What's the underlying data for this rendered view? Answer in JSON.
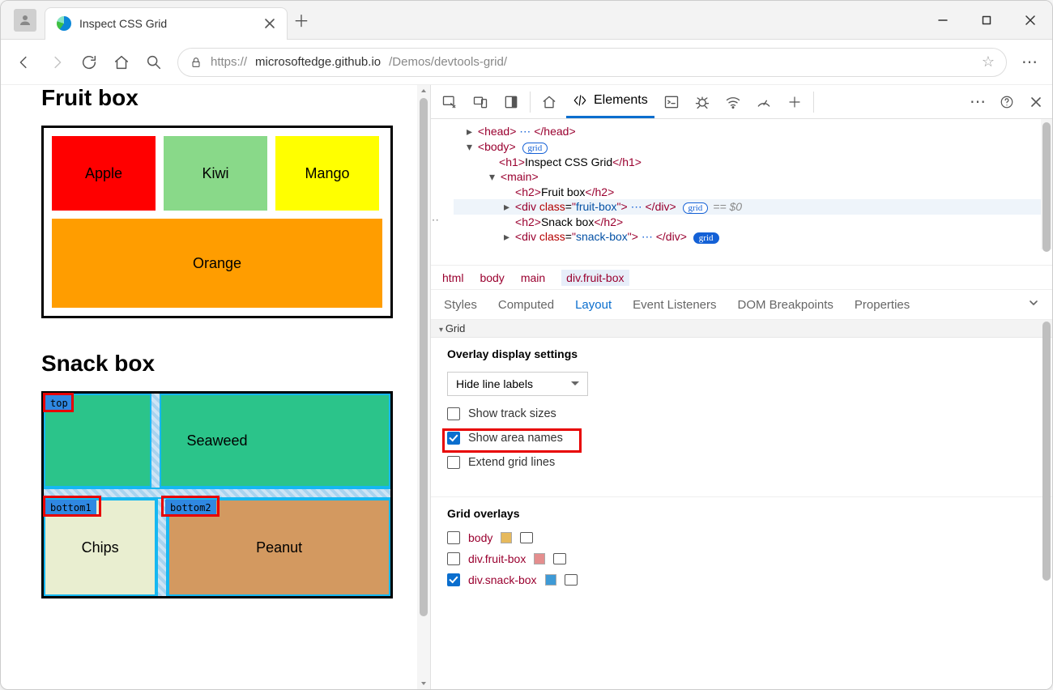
{
  "browser": {
    "tab_title": "Inspect CSS Grid",
    "url_prefix": "https://",
    "url_mid": "microsoftedge.github.io",
    "url_rest": "/Demos/devtools-grid/"
  },
  "page": {
    "h2_fruit": "Fruit box",
    "h2_snack": "Snack box",
    "fruits": {
      "apple": "Apple",
      "kiwi": "Kiwi",
      "mango": "Mango",
      "orange": "Orange"
    },
    "snacks": {
      "seaweed": "Seaweed",
      "chips": "Chips",
      "peanut": "Peanut"
    },
    "area_labels": {
      "top": "top",
      "bottom1": "bottom1",
      "bottom2": "bottom2"
    }
  },
  "dom": {
    "head": "head",
    "body": "body",
    "grid_badge": "grid",
    "h1_text": "Inspect CSS Grid",
    "main": "main",
    "h2_fruit": "Fruit box",
    "h2_snack": "Snack box",
    "div": "div",
    "class_attr": "class",
    "fruit_val": "fruit-box",
    "snack_val": "snack-box",
    "sel_extra": "== $0"
  },
  "breadcrumbs": {
    "html": "html",
    "body": "body",
    "main": "main",
    "sel": "div.fruit-box"
  },
  "styles_tabs": {
    "styles": "Styles",
    "computed": "Computed",
    "layout": "Layout",
    "listeners": "Event Listeners",
    "dombp": "DOM Breakpoints",
    "props": "Properties"
  },
  "layout": {
    "grid_section": "Grid",
    "overlay_h": "Overlay display settings",
    "dropdown": "Hide line labels",
    "opt_tracks": "Show track sizes",
    "opt_areas": "Show area names",
    "opt_extend": "Extend grid lines",
    "overlays_h": "Grid overlays",
    "items": {
      "body": "body",
      "fruit": "div.fruit-box",
      "snack": "div.snack-box"
    }
  },
  "devtools_tabs": {
    "elements": "Elements"
  }
}
